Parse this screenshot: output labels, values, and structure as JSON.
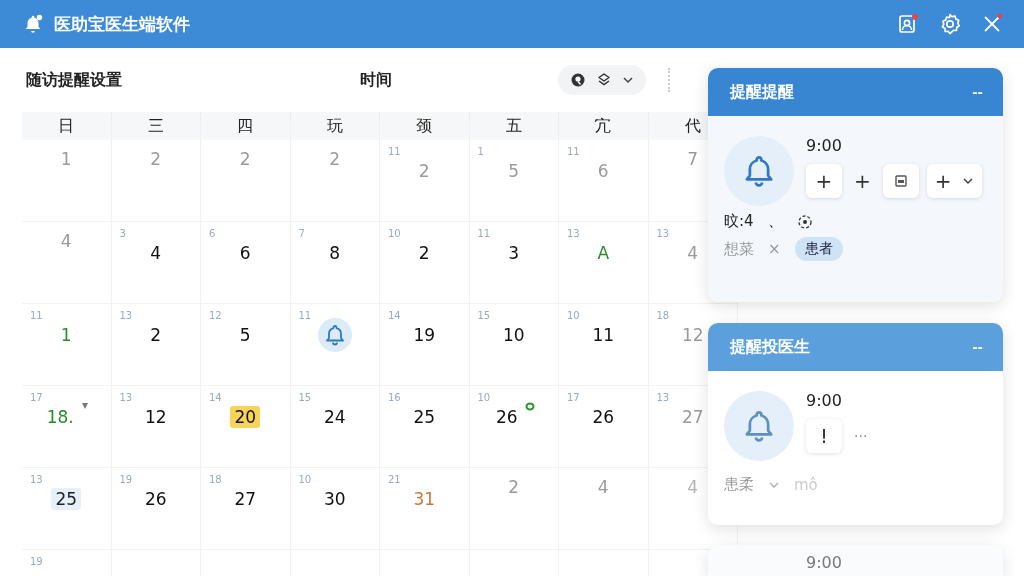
{
  "window": {
    "title": "医助宝医生端软件"
  },
  "toolbar": {
    "title": "随访提醒设置",
    "time_label": "时间"
  },
  "calendar": {
    "weekdays": [
      "日",
      "三",
      "四",
      "玩",
      "颈",
      "五",
      "宂",
      "代"
    ],
    "rows": [
      [
        {
          "day": "1",
          "color": "#9a9a9a"
        },
        {
          "day": "2",
          "color": "#9a9a9a"
        },
        {
          "day": "2",
          "color": "#9a9a9a"
        },
        {
          "day": "2",
          "color": "#9a9a9a"
        },
        {
          "small": "11",
          "day": "2",
          "color": "#9a9a9a"
        },
        {
          "small": "1",
          "day": "5",
          "color": "#9a9a9a"
        },
        {
          "small": "11",
          "day": "6",
          "color": "#9a9a9a"
        },
        {
          "day": "7",
          "color": "#9a9a9a"
        }
      ],
      [
        {
          "day": "4",
          "color": "#9a9a9a"
        },
        {
          "small": "3",
          "day": "4",
          "color": "#111111"
        },
        {
          "small": "6",
          "day": "6",
          "color": "#111111"
        },
        {
          "small": "7",
          "day": "8",
          "color": "#111111"
        },
        {
          "small": "10",
          "day": "2",
          "color": "#111111"
        },
        {
          "small": "11",
          "day": "3",
          "color": "#111111"
        },
        {
          "small": "13",
          "day": "A",
          "color": "#2b8a2b"
        },
        {
          "small": "13",
          "day": "4",
          "color": "#9a9a9a"
        }
      ],
      [
        {
          "small": "11",
          "day": "1",
          "color": "#2b8a2b"
        },
        {
          "small": "13",
          "day": "2",
          "color": "#111111"
        },
        {
          "small": "12",
          "day": "5",
          "color": "#111111"
        },
        {
          "small": "11",
          "kind": "bell"
        },
        {
          "small": "14",
          "day": "19",
          "color": "#111111"
        },
        {
          "small": "15",
          "day": "10",
          "color": "#111111"
        },
        {
          "small": "10",
          "day": "11",
          "color": "#111111"
        },
        {
          "small": "18",
          "day": "12",
          "color": "#9a9a9a"
        }
      ],
      [
        {
          "small": "17",
          "day": "18.",
          "color": "#2b8a2b",
          "kind": "pinned"
        },
        {
          "small": "13",
          "day": "12",
          "color": "#111111"
        },
        {
          "small": "14",
          "day": "20",
          "kind": "today"
        },
        {
          "small": "15",
          "day": "24",
          "color": "#111111"
        },
        {
          "small": "16",
          "day": "25",
          "color": "#111111"
        },
        {
          "small": "10",
          "day": "26",
          "color": "#111111",
          "kind": "ringed"
        },
        {
          "small": "17",
          "day": "26",
          "color": "#111111"
        },
        {
          "small": "13",
          "day": "27",
          "color": "#9a9a9a"
        }
      ],
      [
        {
          "small": "13",
          "day": "25",
          "kind": "marked"
        },
        {
          "small": "19",
          "day": "26",
          "color": "#111111"
        },
        {
          "small": "18",
          "day": "27",
          "color": "#111111"
        },
        {
          "small": "10",
          "day": "30",
          "color": "#111111"
        },
        {
          "small": "21",
          "day": "31",
          "color": "#c9783a"
        },
        {
          "day": "2",
          "color": "#9a9a9a"
        },
        {
          "day": "4",
          "color": "#9a9a9a"
        },
        {
          "day": "4",
          "color": "#b4b4b4"
        }
      ],
      [
        {
          "small": "19"
        },
        {},
        {},
        {},
        {},
        {},
        {},
        {}
      ]
    ]
  },
  "cards": [
    {
      "kind": "full",
      "title": "提醒提醒",
      "collapse": "--",
      "time": "9:00",
      "controls": [
        {
          "kind": "button",
          "label": "+"
        },
        {
          "kind": "text",
          "label": "+"
        },
        {
          "kind": "doc-button"
        },
        {
          "kind": "dropdown",
          "label": "+"
        }
      ],
      "lines": [
        [
          {
            "kind": "text",
            "label": "旼:4"
          },
          {
            "kind": "text",
            "label": "、"
          },
          {
            "kind": "target"
          }
        ],
        [
          {
            "kind": "muted",
            "label": "想菜"
          },
          {
            "kind": "muted",
            "label": "×"
          },
          {
            "kind": "chip",
            "label": "患者"
          }
        ]
      ]
    },
    {
      "kind": "full",
      "title": "提醒投医生",
      "collapse": "--",
      "time": "9:00",
      "controls": [
        {
          "kind": "button",
          "label": "!"
        },
        {
          "kind": "muted",
          "label": "···"
        }
      ],
      "lines": [
        [
          {
            "kind": "muted",
            "label": "患柔"
          },
          {
            "kind": "chevron"
          },
          {
            "kind": "faint",
            "label": "mô"
          }
        ]
      ]
    },
    {
      "kind": "peek",
      "time": "9:00"
    }
  ]
}
